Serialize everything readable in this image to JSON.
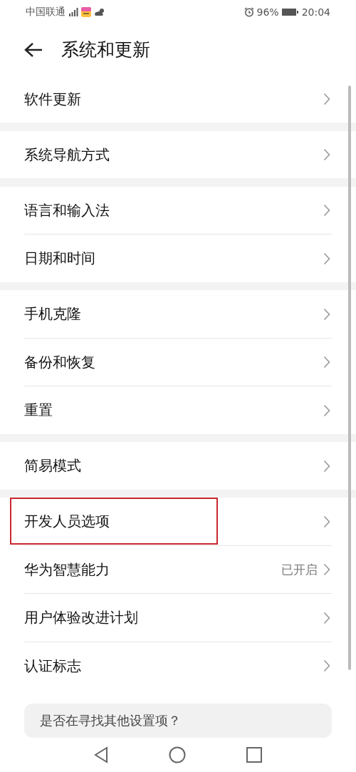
{
  "status_bar": {
    "carrier": "中国联通",
    "battery": "96%",
    "time": "20:04"
  },
  "header": {
    "title": "系统和更新"
  },
  "groups": [
    {
      "items": [
        {
          "label": "软件更新",
          "highlighted": false
        }
      ]
    },
    {
      "items": [
        {
          "label": "系统导航方式",
          "highlighted": false
        }
      ]
    },
    {
      "items": [
        {
          "label": "语言和输入法",
          "highlighted": false
        },
        {
          "label": "日期和时间",
          "highlighted": false
        }
      ]
    },
    {
      "items": [
        {
          "label": "手机克隆",
          "highlighted": false
        },
        {
          "label": "备份和恢复",
          "highlighted": false
        },
        {
          "label": "重置",
          "highlighted": false
        }
      ]
    },
    {
      "items": [
        {
          "label": "简易模式",
          "highlighted": false
        }
      ]
    },
    {
      "items": [
        {
          "label": "开发人员选项",
          "highlighted": true
        },
        {
          "label": "华为智慧能力",
          "value": "已开启",
          "highlighted": false
        },
        {
          "label": "用户体验改进计划",
          "highlighted": false
        },
        {
          "label": "认证标志",
          "highlighted": false
        }
      ]
    }
  ],
  "suggestion_card": {
    "title": "是否在寻找其他设置项？"
  }
}
